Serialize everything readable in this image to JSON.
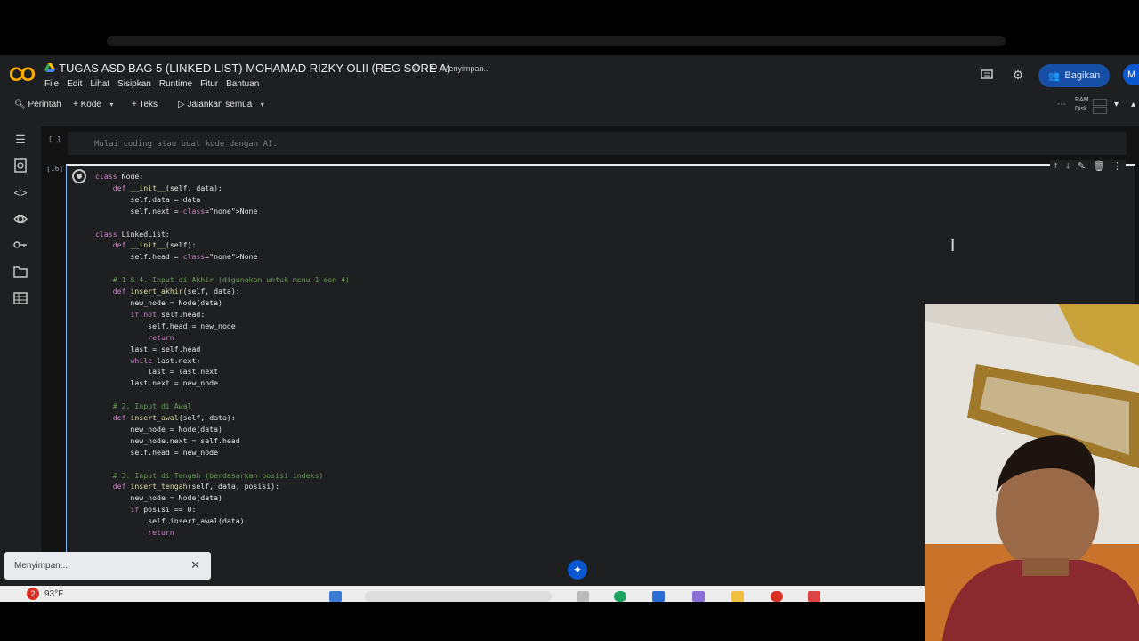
{
  "header": {
    "logo": "CO",
    "title": "TUGAS ASD BAG 5 (LINKED LIST) MOHAMAD RIZKY OLII (REG SORE A)",
    "save_status": "Menyimpan...",
    "share_label": "Bagikan",
    "avatar_initial": "M",
    "menu": [
      "File",
      "Edit",
      "Lihat",
      "Sisipkan",
      "Runtime",
      "Fitur",
      "Bantuan"
    ]
  },
  "toolbar": {
    "command_label": "Perintah",
    "add_code_label": "Kode",
    "add_text_label": "Teks",
    "run_all_label": "Jalankan semua",
    "ram_label": "RAM",
    "disk_label": "Disk"
  },
  "cells": {
    "empty_bracket": "[ ]",
    "empty_placeholder": "Mulai coding atau buat kode dengan AI.",
    "exec_count": "[16]"
  },
  "code_lines": [
    "class Node:",
    "    def __init__(self, data):",
    "        self.data = data",
    "        self.next = None",
    "",
    "class LinkedList:",
    "    def __init__(self):",
    "        self.head = None",
    "",
    "    # 1 & 4. Input di Akhir (digunakan untuk menu 1 dan 4)",
    "    def insert_akhir(self, data):",
    "        new_node = Node(data)",
    "        if not self.head:",
    "            self.head = new_node",
    "            return",
    "        last = self.head",
    "        while last.next:",
    "            last = last.next",
    "        last.next = new_node",
    "",
    "    # 2. Input di Awal",
    "    def insert_awal(self, data):",
    "        new_node = Node(data)",
    "        new_node.next = self.head",
    "        self.head = new_node",
    "",
    "    # 3. Input di Tengah (berdasarkan posisi indeks)",
    "    def insert_tengah(self, data, posisi):",
    "        new_node = Node(data)",
    "        if posisi == 0:",
    "            self.insert_awal(data)",
    "            return"
  ],
  "toast": {
    "text": "Menyimpan...",
    "close": "✕"
  },
  "taskbar": {
    "weather_badge": "2",
    "weather_temp": "93°F"
  },
  "colors": {
    "accent_blue": "#0b57d0",
    "share_bg": "#174ea6",
    "logo_orange": "#f9ab00",
    "bg": "#1e1f20"
  }
}
